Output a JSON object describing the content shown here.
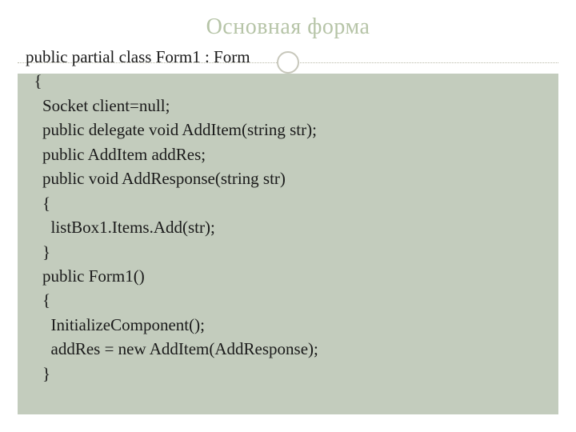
{
  "slide": {
    "title": "Основная форма",
    "code_lines": [
      "public partial class Form1 : Form",
      "  {",
      "    Socket client=null;",
      "    public delegate void AddItem(string str);",
      "    public AddItem addRes;",
      "    public void AddResponse(string str)",
      "    {",
      "      listBox1.Items.Add(str);",
      "    }",
      "    public Form1()",
      "    {",
      "      InitializeComponent();",
      "      addRes = new AddItem(AddResponse);",
      "    }"
    ]
  }
}
